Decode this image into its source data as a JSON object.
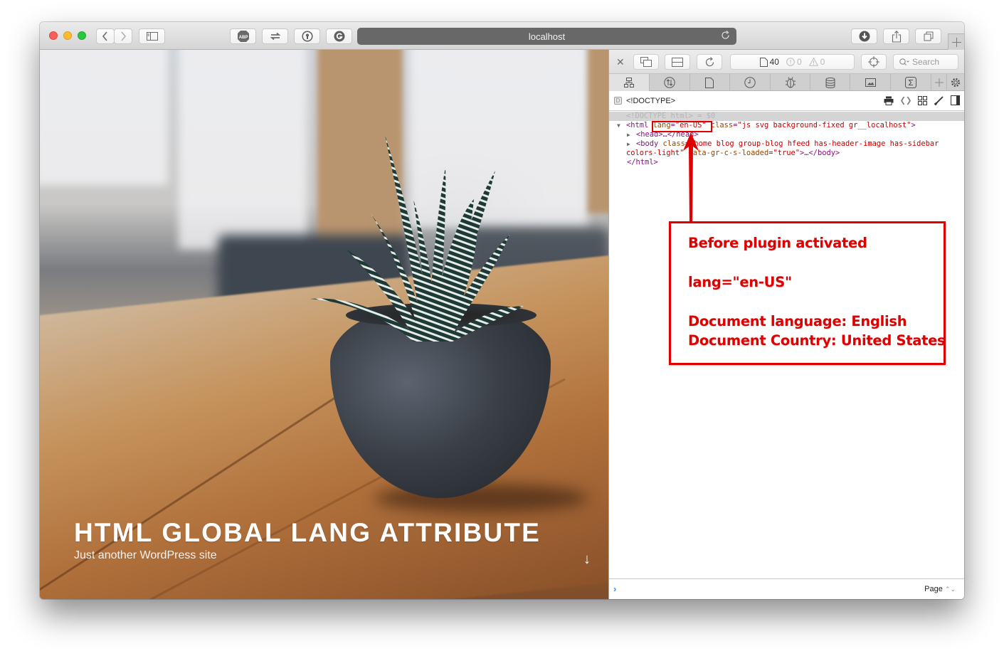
{
  "browser": {
    "url": "localhost",
    "toolbar_buttons": [
      {
        "name": "back",
        "icon": "chevron-left-icon"
      },
      {
        "name": "forward",
        "icon": "chevron-right-icon"
      },
      {
        "name": "sidebar",
        "icon": "sidebar-icon"
      },
      {
        "name": "adblock",
        "icon": "abp-icon",
        "label": "ABP"
      },
      {
        "name": "sync",
        "icon": "arrows-exchange-icon"
      },
      {
        "name": "password",
        "icon": "keyhole-icon"
      },
      {
        "name": "grammarly",
        "icon": "grammarly-icon",
        "label": "G"
      },
      {
        "name": "downloads",
        "icon": "download-icon"
      },
      {
        "name": "share",
        "icon": "share-icon"
      },
      {
        "name": "tabs",
        "icon": "tabs-overview-icon"
      },
      {
        "name": "new-tab",
        "icon": "plus-icon"
      }
    ]
  },
  "website": {
    "title": "HTML GLOBAL LANG ATTRIBUTE",
    "tagline": "Just another WordPress site",
    "scroll_icon": "↓"
  },
  "inspector": {
    "counts": {
      "resources": "40",
      "errors": "0",
      "warnings": "0"
    },
    "search_placeholder": "Search",
    "tabs": [
      {
        "name": "elements",
        "icon": "elements-icon",
        "active": true
      },
      {
        "name": "network",
        "icon": "network-icon"
      },
      {
        "name": "resources",
        "icon": "resources-icon"
      },
      {
        "name": "timelines",
        "icon": "timelines-icon"
      },
      {
        "name": "debugger",
        "icon": "debugger-icon"
      },
      {
        "name": "storage",
        "icon": "storage-icon"
      },
      {
        "name": "canvas",
        "icon": "canvas-icon"
      },
      {
        "name": "console",
        "icon": "console-icon"
      },
      {
        "name": "add-tab",
        "icon": "plus-icon"
      },
      {
        "name": "settings",
        "icon": "gear-icon"
      }
    ],
    "breadcrumb": "<!DOCTYPE>",
    "dom": {
      "doctype_ghost": "<!DOCTYPE html> = $0",
      "html_open": "<html",
      "html_lang_attr": "lang",
      "html_lang_val": "\"en-US\"",
      "html_class_attr": "class",
      "html_class_val": "\"js svg background-fixed gr__localhost\"",
      "html_close_bracket": ">",
      "head_line": "<head>…</head>",
      "body_open": "<body",
      "body_class_attr": "class",
      "body_class_val_1": "\"home blog group-blog hfeed has-header-image has-sidebar",
      "body_class_val_2": "colors-light\"",
      "body_data_attr": "data-gr-c-s-loaded",
      "body_data_val": "\"true\"",
      "body_rest": ">…</body>",
      "html_end": "</html>"
    },
    "console_mode": "Page"
  },
  "annotation": {
    "color": "#e00000",
    "lines": [
      "Before plugin activated",
      "lang=\"en-US\"",
      "Document language: English",
      "Document Country: United States"
    ]
  }
}
